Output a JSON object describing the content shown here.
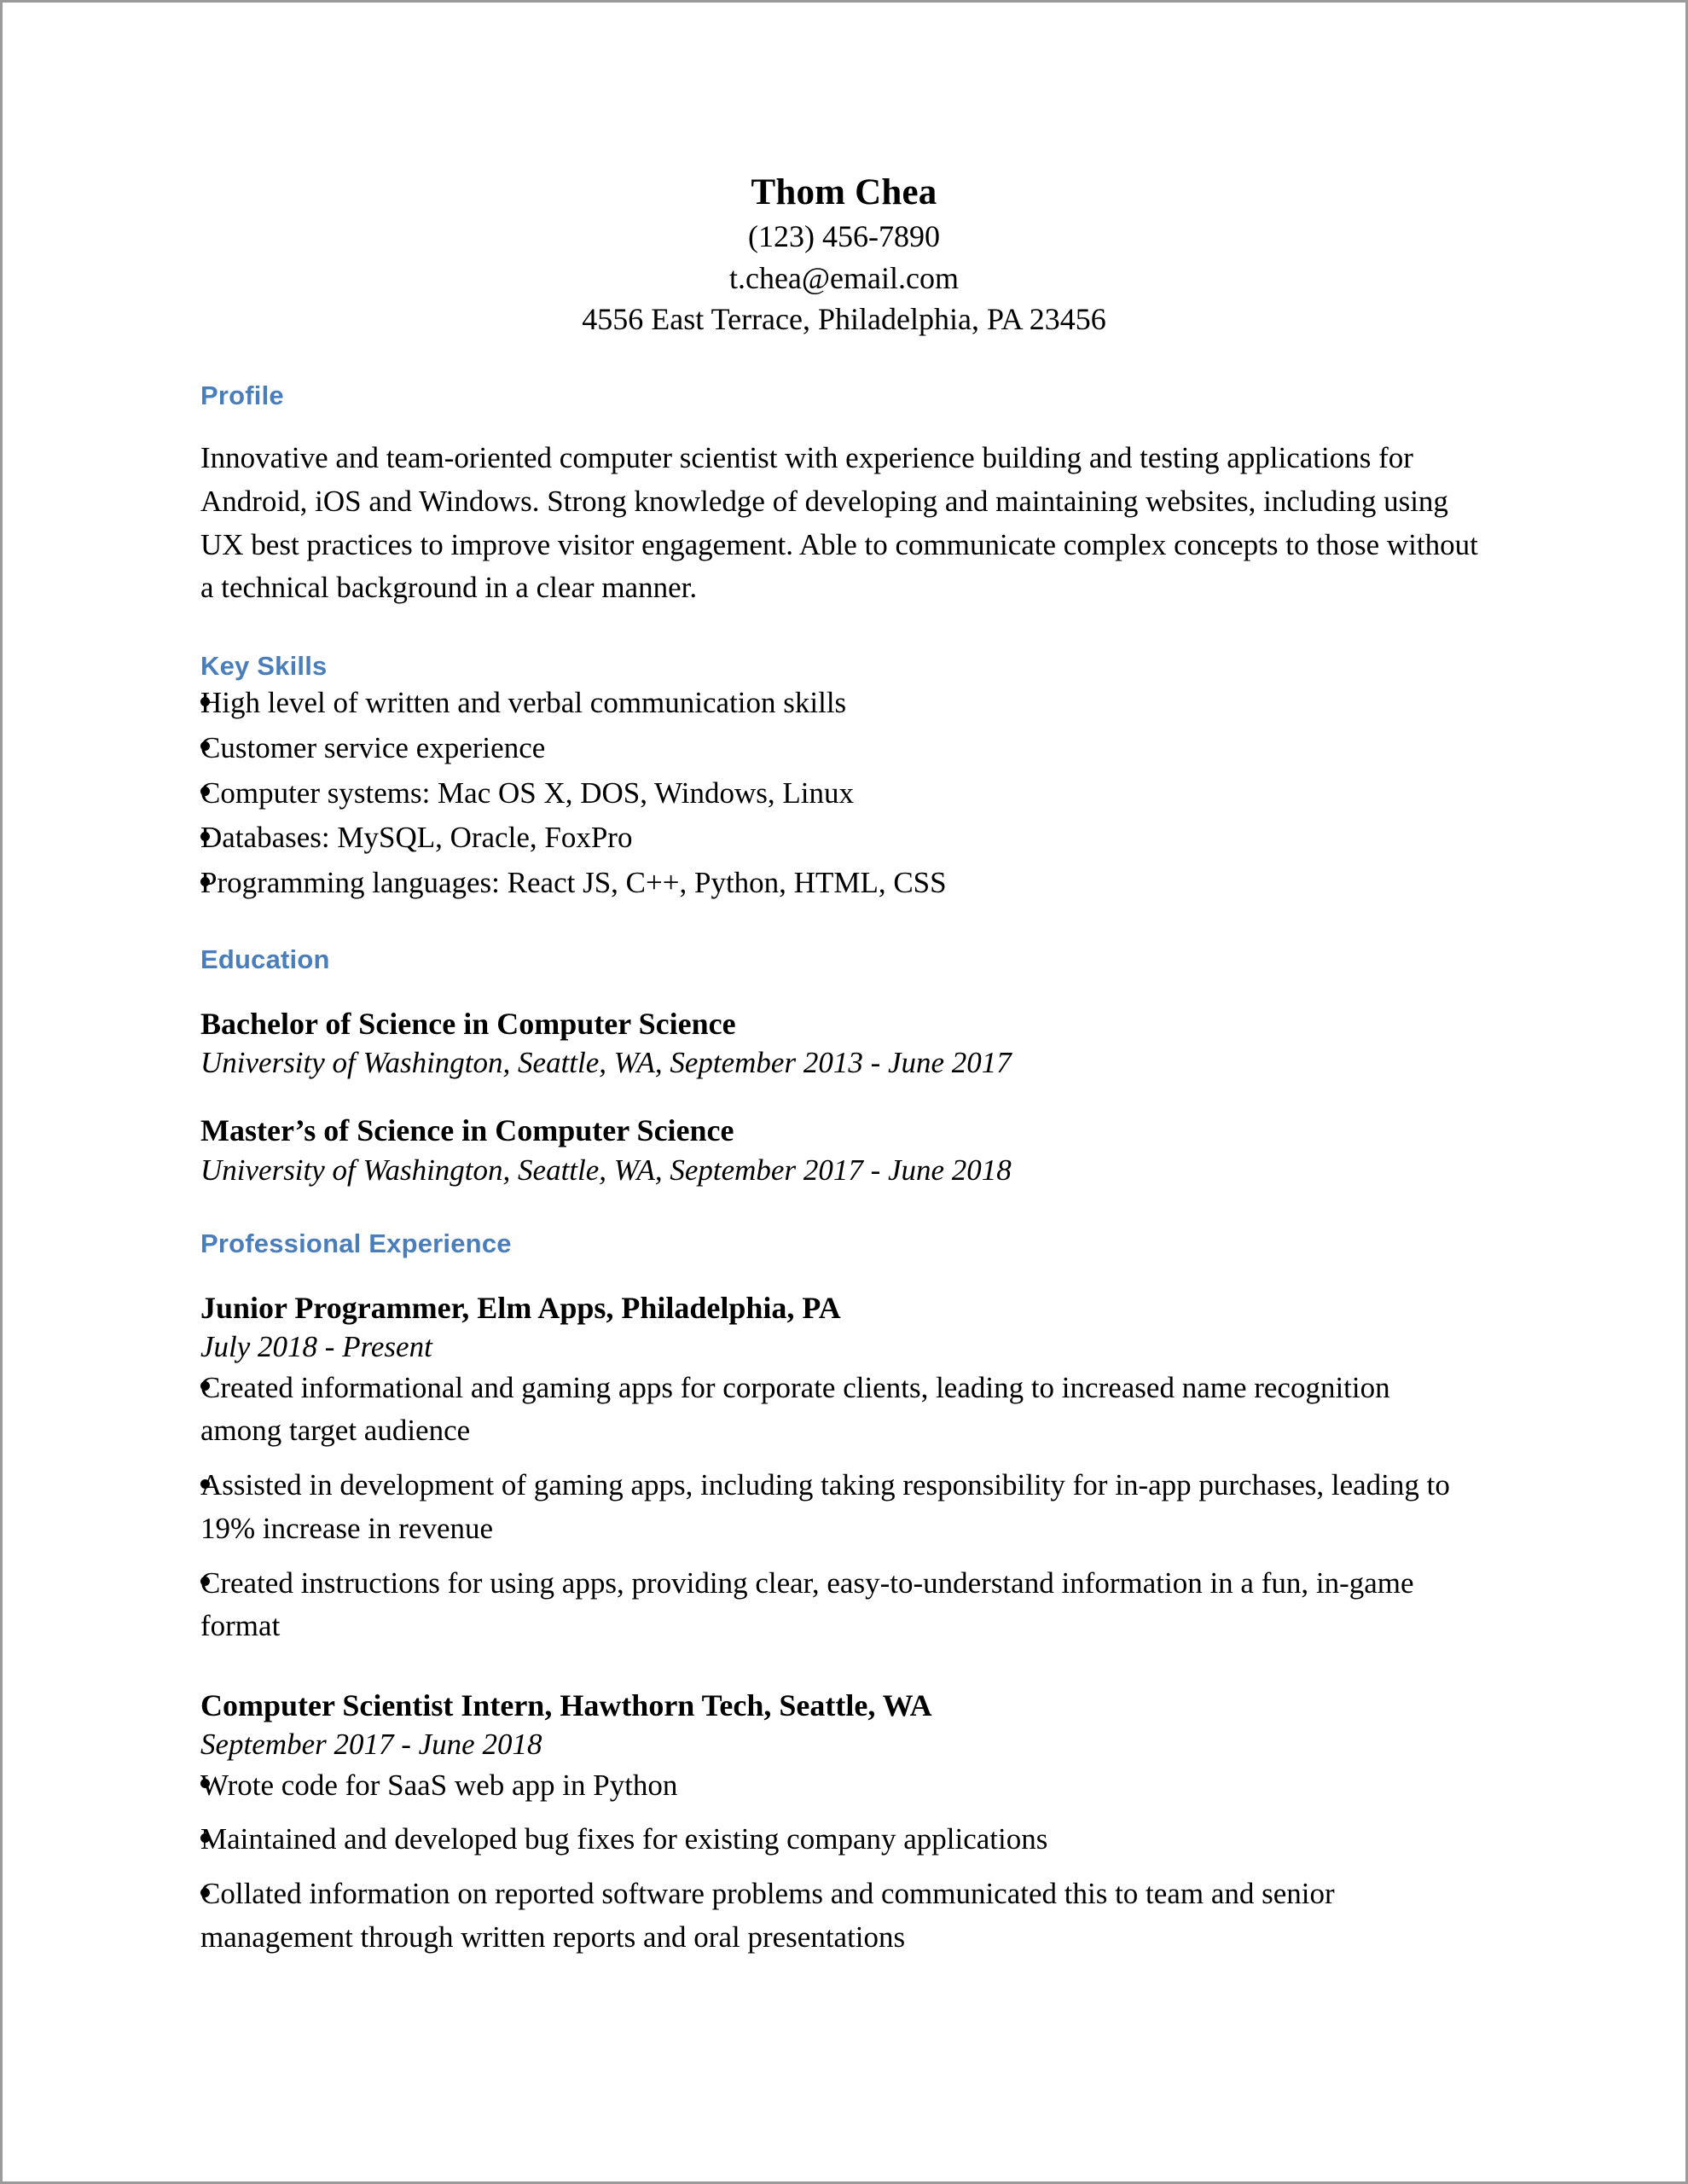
{
  "document": {
    "type": "resume",
    "accent_color": "#4a7ebb",
    "text_color": "#000000",
    "background_color": "#ffffff",
    "border_color": "#9b9b9b"
  },
  "header": {
    "name": "Thom Chea",
    "phone": "(123) 456-7890",
    "email": "t.chea@email.com",
    "address": "4556 East Terrace, Philadelphia, PA 23456"
  },
  "sections": {
    "profile": {
      "heading": "Profile",
      "paragraph": "Innovative and team-oriented computer scientist with experience building and testing applications for Android, iOS and Windows. Strong knowledge of developing and maintaining websites, including using UX best practices to improve visitor engagement. Able to communicate complex concepts to those without a technical background in a clear manner."
    },
    "key_skills": {
      "heading": "Key Skills",
      "items": [
        "High level of written and verbal communication skills",
        "Customer service experience",
        "Computer systems: Mac OS X, DOS, Windows, Linux",
        "Databases: MySQL, Oracle, FoxPro",
        "Programming languages: React JS, C++, Python, HTML, CSS"
      ]
    },
    "education": {
      "heading": "Education",
      "entries": [
        {
          "degree": "Bachelor of Science in Computer Science",
          "institution": "University of Washington, Seattle, WA, September 2013 - June 2017"
        },
        {
          "degree": "Master’s of Science in Computer Science",
          "institution": "University of Washington, Seattle, WA, September 2017 - June 2018"
        }
      ]
    },
    "professional_experience": {
      "heading": "Professional Experience",
      "entries": [
        {
          "title": "Junior Programmer, Elm Apps, Philadelphia, PA",
          "dates": "July 2018 - Present",
          "bullets": [
            "Created informational and gaming apps for corporate clients, leading to increased name recognition among target audience",
            "Assisted in development of gaming apps, including taking responsibility for in-app purchases, leading to 19% increase in revenue",
            "Created instructions for using apps, providing clear, easy-to-understand information in a fun, in-game format"
          ]
        },
        {
          "title": "Computer Scientist Intern, Hawthorn Tech, Seattle, WA",
          "dates": "September 2017 - June 2018",
          "bullets": [
            "Wrote code for SaaS web app in Python",
            "Maintained and developed bug fixes for existing company applications",
            "Collated information on reported software problems and communicated this to team and senior management through written reports and oral presentations"
          ]
        }
      ]
    }
  }
}
